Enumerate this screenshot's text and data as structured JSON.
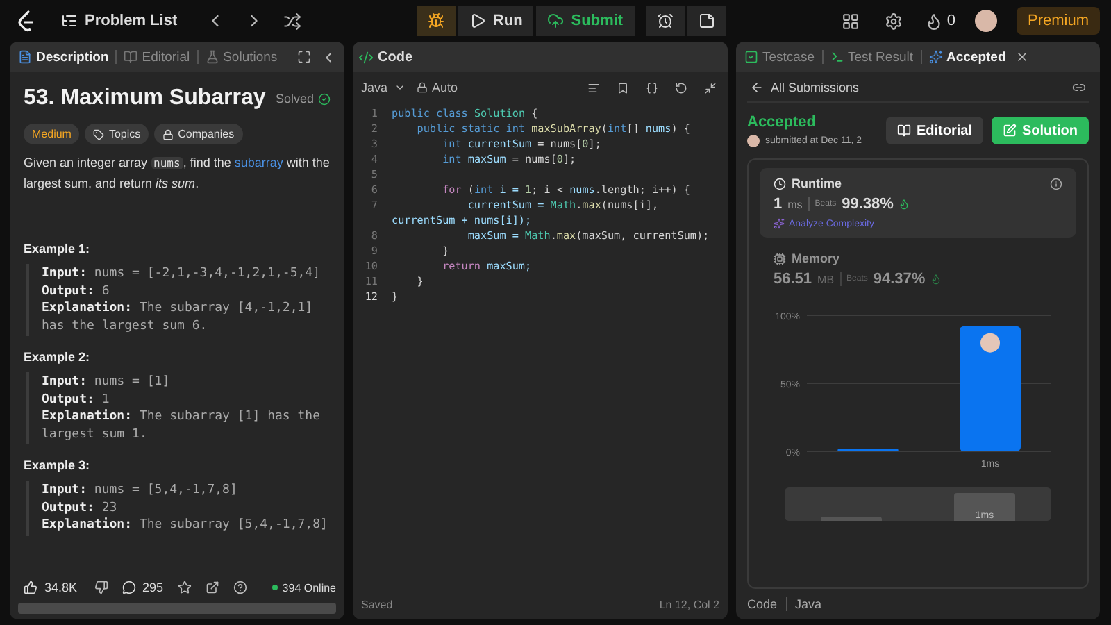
{
  "top_bar": {
    "problem_list": "Problem List",
    "run": "Run",
    "submit": "Submit",
    "streak": "0",
    "premium": "Premium"
  },
  "description_panel": {
    "tabs": [
      {
        "label": "Description",
        "selected": true
      },
      {
        "label": "Editorial",
        "selected": false
      },
      {
        "label": "Solutions",
        "selected": false
      }
    ],
    "title": "53. Maximum Subarray",
    "status": "Solved",
    "difficulty": "Medium",
    "chips": [
      "Topics",
      "Companies"
    ],
    "statement": [
      {
        "kind": "text",
        "text": "Given an integer array "
      },
      {
        "kind": "code",
        "text": "nums"
      },
      {
        "kind": "text",
        "text": ", find the "
      },
      {
        "kind": "link",
        "text": "subarray"
      },
      {
        "kind": "text",
        "text": " with the largest sum, and return *its sum*."
      }
    ],
    "examples": [
      {
        "title": "Example 1:",
        "lines": [
          "**Input:** nums = [-2,1,-3,4,-1,2,1,-5,4]",
          "**Output:** 6",
          "**Explanation:** The subarray [4,-1,2,1] has the largest sum 6."
        ]
      },
      {
        "title": "Example 2:",
        "lines": [
          "**Input:** nums = [1]",
          "**Output:** 1",
          "**Explanation:** The subarray [1] has the largest sum 1."
        ]
      },
      {
        "title": "Example 3:",
        "lines": [
          "**Input:** nums = [5,4,-1,7,8]",
          "**Output:** 23",
          "**Explanation:** The subarray [5,4,-1,7,8]"
        ]
      }
    ],
    "footer": {
      "likes": "34.8K",
      "comments": "295",
      "online": "394 Online"
    }
  },
  "code_panel": {
    "title": "Code",
    "language": "Java",
    "mode": "Auto",
    "status": "Saved",
    "cursor": "Ln 12, Col 2",
    "rows": [
      {
        "number": "1",
        "segs": [
          {
            "t": "public class ",
            "kind": "kw"
          },
          {
            "t": "Solution",
            "kind": "ty"
          },
          {
            "t": " {",
            "kind": "p"
          }
        ]
      },
      {
        "number": "2",
        "segs": [
          {
            "t": "    public static int ",
            "kind": "kw"
          },
          {
            "t": "maxSubArray",
            "kind": "fn"
          },
          {
            "t": "(",
            "kind": "p"
          },
          {
            "t": "int",
            "kind": "kw"
          },
          {
            "t": "[] ",
            "kind": "p"
          },
          {
            "t": "nums",
            "kind": "var"
          },
          {
            "t": ") {",
            "kind": "p"
          }
        ]
      },
      {
        "number": "3",
        "segs": [
          {
            "t": "        int ",
            "kind": "kw"
          },
          {
            "t": "currentSum",
            "kind": "var"
          },
          {
            "t": " = nums[",
            "kind": "p"
          },
          {
            "t": "0",
            "kind": "num"
          },
          {
            "t": "];",
            "kind": "p"
          }
        ]
      },
      {
        "number": "4",
        "segs": [
          {
            "t": "        int ",
            "kind": "kw"
          },
          {
            "t": "maxSum",
            "kind": "var"
          },
          {
            "t": " = nums[",
            "kind": "p"
          },
          {
            "t": "0",
            "kind": "num"
          },
          {
            "t": "];",
            "kind": "p"
          }
        ]
      },
      {
        "number": "5",
        "segs": []
      },
      {
        "number": "6",
        "segs": [
          {
            "t": "        for ",
            "kind": "ctl"
          },
          {
            "t": "(",
            "kind": "p"
          },
          {
            "t": "int ",
            "kind": "kw"
          },
          {
            "t": "i = ",
            "kind": "var"
          },
          {
            "t": "1",
            "kind": "num"
          },
          {
            "t": "; i < ",
            "kind": "p"
          },
          {
            "t": "nums",
            "kind": "var"
          },
          {
            "t": ".length; i++) {",
            "kind": "p"
          }
        ]
      },
      {
        "number": "7",
        "segs": [
          {
            "t": "            currentSum = ",
            "kind": "var"
          },
          {
            "t": "Math",
            "kind": "ty"
          },
          {
            "t": ".",
            "kind": "p"
          },
          {
            "t": "max",
            "kind": "fn"
          },
          {
            "t": "(nums[i],",
            "kind": "p"
          }
        ]
      },
      {
        "segs": [
          {
            "t": "currentSum + nums[i]);",
            "kind": "var"
          }
        ]
      },
      {
        "number": "8",
        "segs": [
          {
            "t": "            maxSum = ",
            "kind": "var"
          },
          {
            "t": "Math",
            "kind": "ty"
          },
          {
            "t": ".",
            "kind": "p"
          },
          {
            "t": "max",
            "kind": "fn"
          },
          {
            "t": "(maxSum, currentSum);",
            "kind": "p"
          }
        ]
      },
      {
        "number": "9",
        "segs": [
          {
            "t": "        }",
            "kind": "p"
          }
        ]
      },
      {
        "number": "10",
        "segs": [
          {
            "t": "        return ",
            "kind": "ctl"
          },
          {
            "t": "maxSum;",
            "kind": "var"
          }
        ]
      },
      {
        "number": "11",
        "segs": [
          {
            "t": "    }",
            "kind": "p"
          }
        ]
      },
      {
        "number": "12",
        "segs": [
          {
            "t": "}",
            "kind": "p"
          }
        ]
      }
    ]
  },
  "result_panel": {
    "tabs": [
      {
        "label": "Testcase",
        "selected": false
      },
      {
        "label": "Test Result",
        "selected": false
      },
      {
        "label": "Accepted",
        "selected": true
      }
    ],
    "back": "All Submissions",
    "verdict": "Accepted",
    "submitted": "submitted at Dec 11, 2",
    "buttons": [
      "Editorial",
      "Solution"
    ],
    "metrics": [
      {
        "kind": "time",
        "label": "Runtime",
        "value": "1",
        "unit": "ms",
        "beats_label": "Beats",
        "beats": "99.38%",
        "selected": true,
        "action": "Analyze Complexity"
      },
      {
        "kind": "memory",
        "label": "Memory",
        "value": "56.51",
        "unit": "MB",
        "beats_label": "Beats",
        "beats": "94.37%",
        "selected": false
      }
    ],
    "chart_data": {
      "type": "bar",
      "categories": [
        null,
        "1ms"
      ],
      "series": [
        {
          "color": "#0a74f0",
          "values": [
            2,
            92
          ]
        }
      ],
      "ylim": [
        0,
        100
      ],
      "yticks": [
        {
          "value": 0,
          "label": "0%"
        },
        {
          "value": 50,
          "label": "50%"
        },
        {
          "value": 100,
          "label": "100%"
        }
      ]
    },
    "brush_label": "1ms",
    "footer": [
      "Code",
      "Java"
    ]
  }
}
